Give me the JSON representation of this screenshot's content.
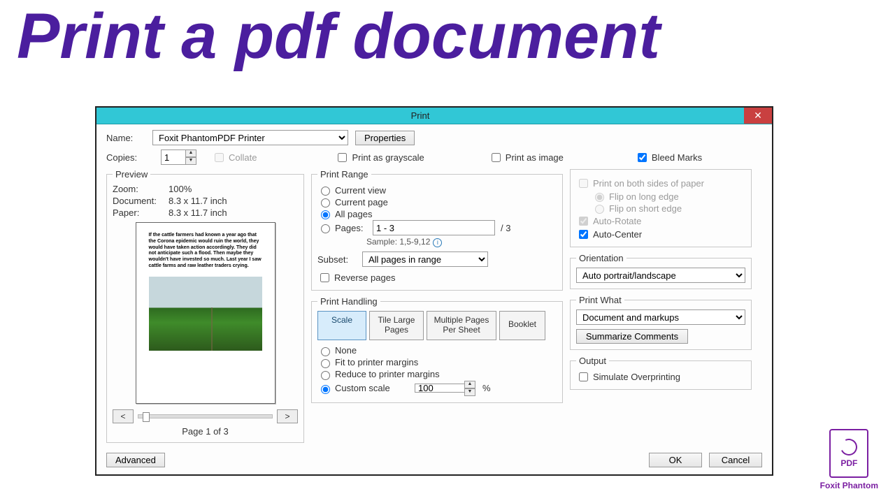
{
  "headline": "Print a pdf document",
  "dialog_title": "Print",
  "name_label": "Name:",
  "printer": "Foxit PhantomPDF Printer",
  "properties_btn": "Properties",
  "copies_label": "Copies:",
  "copies_value": "1",
  "collate_label": "Collate",
  "grayscale_label": "Print as grayscale",
  "as_image_label": "Print as image",
  "bleed_label": "Bleed Marks",
  "preview": {
    "legend": "Preview",
    "zoom_k": "Zoom:",
    "zoom_v": "100%",
    "doc_k": "Document:",
    "doc_v": "8.3 x 11.7 inch",
    "paper_k": "Paper:",
    "paper_v": "8.3 x 11.7 inch",
    "sample_text": "If the cattle farmers had known a year ago that the Corona epidemic would ruin the world, they would have taken action accordingly. They did not anticipate such a flood. Then maybe they wouldn't have invested so much. Last year I saw cattle farms and raw leather traders crying.",
    "prev": "<",
    "next": ">",
    "page_of": "Page 1 of 3"
  },
  "range": {
    "legend": "Print Range",
    "current_view": "Current view",
    "current_page": "Current page",
    "all_pages": "All pages",
    "pages": "Pages:",
    "pages_value": "1 - 3",
    "pages_total": "/ 3",
    "sample": "Sample: 1,5-9,12",
    "subset_label": "Subset:",
    "subset_value": "All pages in range",
    "reverse": "Reverse pages"
  },
  "handling": {
    "legend": "Print Handling",
    "tabs": {
      "scale": "Scale",
      "tile": "Tile Large\nPages",
      "multi": "Multiple Pages\nPer Sheet",
      "booklet": "Booklet"
    },
    "none": "None",
    "fit": "Fit to printer margins",
    "reduce": "Reduce to printer margins",
    "custom": "Custom scale",
    "custom_value": "100",
    "percent": "%"
  },
  "right": {
    "both_sides": "Print on both sides of paper",
    "flip_long": "Flip on long edge",
    "flip_short": "Flip on short edge",
    "auto_rotate": "Auto-Rotate",
    "auto_center": "Auto-Center",
    "orientation_legend": "Orientation",
    "orientation_value": "Auto portrait/landscape",
    "print_what_legend": "Print What",
    "print_what_value": "Document and markups",
    "summarize": "Summarize Comments",
    "output_legend": "Output",
    "overprint": "Simulate Overprinting"
  },
  "footer": {
    "advanced": "Advanced",
    "ok": "OK",
    "cancel": "Cancel"
  },
  "logo": {
    "pdf": "PDF",
    "caption": "Foxit Phantom"
  }
}
